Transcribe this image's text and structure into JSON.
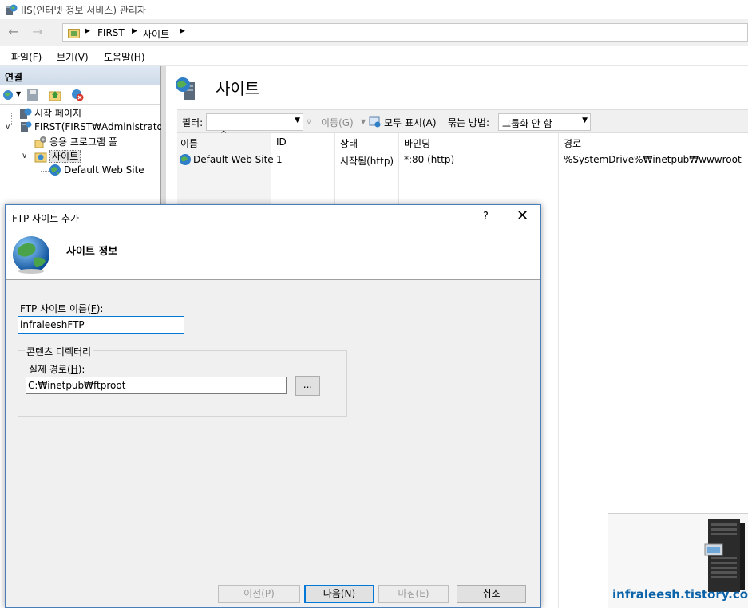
{
  "window": {
    "title": "IIS(인터넷 정보 서비스) 관리자"
  },
  "nav": {
    "back_icon": "back-arrow-icon",
    "forward_icon": "forward-arrow-icon",
    "breadcrumb": [
      "FIRST",
      "사이트"
    ]
  },
  "menu": {
    "file": "파일(F)",
    "view": "보기(V)",
    "help": "도움말(H)"
  },
  "connections": {
    "header": "연결",
    "tree": {
      "start_page": "시작 페이지",
      "server": "FIRST(FIRST₩Administrator)",
      "app_pools": "응용 프로그램 풀",
      "sites": "사이트",
      "default_site": "Default Web Site"
    }
  },
  "main": {
    "title": "사이트",
    "filter": {
      "label": "필터:",
      "go": "이동(G)",
      "show_all": "모두 표시(A)",
      "group_by_label": "묶는 방법:",
      "group_by_value": "그룹화 안 함"
    },
    "columns": [
      "이름",
      "ID",
      "상태",
      "바인딩",
      "경로"
    ],
    "rows": [
      {
        "name": "Default Web Site",
        "id": "1",
        "status": "시작됨(http)",
        "binding": "*:80 (http)",
        "path": "%SystemDrive%₩inetpub₩wwwroot"
      }
    ]
  },
  "dialog": {
    "title": "FTP 사이트 추가",
    "help": "?",
    "close": "✕",
    "banner_title": "사이트 정보",
    "site_name_label": "FTP 사이트 이름(",
    "site_name_key": "F",
    "site_name_suffix": "):",
    "site_name_value": "infraleeshFTP",
    "content_dir_legend": "콘텐츠 디렉터리",
    "physical_path_label": "실제 경로(",
    "physical_path_key": "H",
    "physical_path_suffix": "):",
    "physical_path_value": "C:₩inetpub₩ftproot",
    "browse": "...",
    "buttons": {
      "prev_label": "이전(",
      "prev_key": "P",
      "next_label": "다음(",
      "next_key": "N",
      "finish_label": "마침(",
      "finish_key": "E",
      "cancel": "취소",
      "close_paren": ")"
    }
  },
  "watermark": {
    "text": "infraleesh.tistory.com"
  },
  "colors": {
    "accent": "#0078d7",
    "dialog_border": "#4a7eb8",
    "watermark": "#0a62a8"
  }
}
